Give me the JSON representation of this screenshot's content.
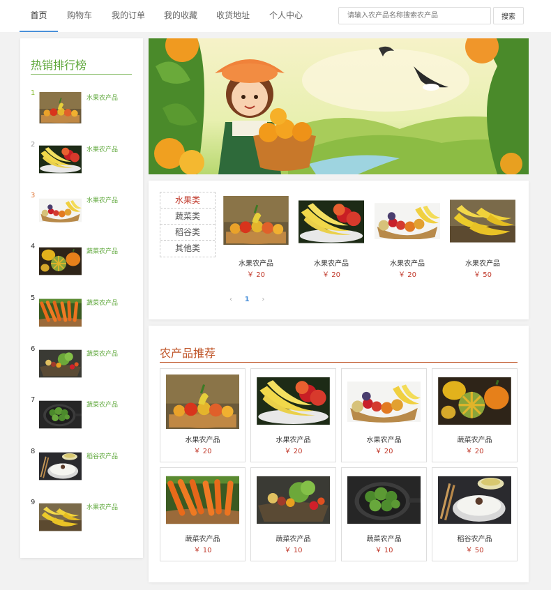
{
  "nav": {
    "items": [
      "首页",
      "购物车",
      "我的订单",
      "我的收藏",
      "收货地址",
      "个人中心"
    ],
    "search_placeholder": "请输入农产品名称搜索农产品",
    "search_button": "搜索"
  },
  "sidebar": {
    "title": "热销排行榜",
    "items": [
      {
        "rank": "1",
        "label": "水果农产品",
        "img": "fruit-basket"
      },
      {
        "rank": "2",
        "label": "水果农产品",
        "img": "banana-apple"
      },
      {
        "rank": "3",
        "label": "水果农产品",
        "img": "fruit-mix"
      },
      {
        "rank": "4",
        "label": "蔬菜农产品",
        "img": "pumpkins"
      },
      {
        "rank": "5",
        "label": "蔬菜农产品",
        "img": "carrots"
      },
      {
        "rank": "6",
        "label": "蔬菜农产品",
        "img": "veg-basket"
      },
      {
        "rank": "7",
        "label": "蔬菜农产品",
        "img": "broccoli"
      },
      {
        "rank": "8",
        "label": "稻谷农产品",
        "img": "rice"
      },
      {
        "rank": "9",
        "label": "水果农产品",
        "img": "bananas"
      }
    ]
  },
  "categories": {
    "items": [
      "水果类",
      "蔬菜类",
      "稻谷类",
      "其他类"
    ],
    "active": 0,
    "products": [
      {
        "name": "水果农产品",
        "price": "￥ 20",
        "img": "fruit-basket"
      },
      {
        "name": "水果农产品",
        "price": "￥ 20",
        "img": "banana-apple"
      },
      {
        "name": "水果农产品",
        "price": "￥ 20",
        "img": "fruit-mix"
      },
      {
        "name": "水果农产品",
        "price": "￥ 50",
        "img": "bananas"
      }
    ],
    "pager": {
      "prev": "‹",
      "current": "1",
      "next": "›"
    }
  },
  "recommend": {
    "title": "农产品推荐",
    "items": [
      {
        "name": "水果农产品",
        "price": "￥ 20",
        "img": "fruit-basket"
      },
      {
        "name": "水果农产品",
        "price": "￥ 20",
        "img": "banana-apple"
      },
      {
        "name": "水果农产品",
        "price": "￥ 20",
        "img": "fruit-mix"
      },
      {
        "name": "蔬菜农产品",
        "price": "￥ 20",
        "img": "pumpkins"
      },
      {
        "name": "蔬菜农产品",
        "price": "￥ 10",
        "img": "carrots"
      },
      {
        "name": "蔬菜农产品",
        "price": "￥ 10",
        "img": "veg-basket"
      },
      {
        "name": "蔬菜农产品",
        "price": "￥ 10",
        "img": "broccoli"
      },
      {
        "name": "稻谷农产品",
        "price": "￥ 50",
        "img": "rice"
      }
    ]
  },
  "colors": {
    "green": "#5ea73a",
    "price_red": "#c0392b",
    "accent_orange": "#c0572b",
    "nav_active": "#4a90d9"
  }
}
